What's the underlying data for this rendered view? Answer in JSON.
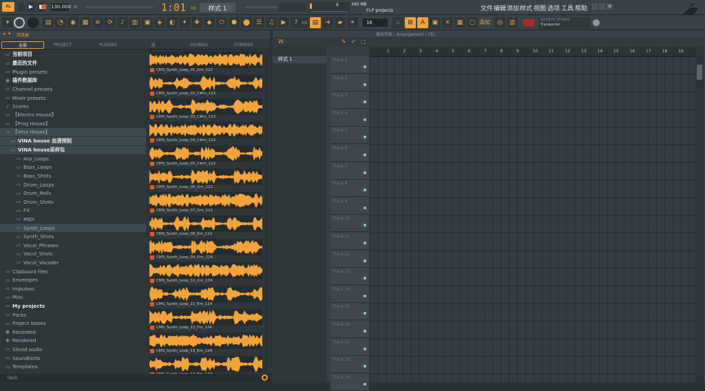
{
  "topbar": {
    "tempo": "130.000",
    "time": "1:01",
    "time_sub": "00",
    "pattern": "样式 1",
    "memory": "345 MB",
    "cpu": "6",
    "project_hint": "FLP projects",
    "menu": [
      "文件",
      "编辑",
      "添加",
      "样式",
      "视图",
      "选项",
      "工具",
      "帮助"
    ]
  },
  "toolbar": {
    "snap": "16",
    "add_label": "添加",
    "news_line1": "10/18 FL STUDIO",
    "news_line2": "Transporter"
  },
  "browser": {
    "title": "浏览器",
    "tabs": [
      "全部",
      "PROJECT",
      "PLUGINS",
      "库",
      "SOUNDS",
      "STARRED"
    ],
    "tree": [
      {
        "label": "当前项目",
        "icon": "▭",
        "style": "bold"
      },
      {
        "label": "最近的文件",
        "icon": "▭",
        "style": "bold"
      },
      {
        "label": "Plugin presets",
        "icon": "▭",
        "style": ""
      },
      {
        "label": "插件数据库",
        "icon": "◉",
        "style": "bold"
      },
      {
        "label": "Channel presets",
        "icon": "▭",
        "style": ""
      },
      {
        "label": "Mixer presets",
        "icon": "▭",
        "style": ""
      },
      {
        "label": "Scores",
        "icon": "♪",
        "style": ""
      },
      {
        "label": "【Electro House】",
        "icon": "▭",
        "style": ""
      },
      {
        "label": "【Prog House】",
        "icon": "▭",
        "style": ""
      },
      {
        "label": "【Vina House】",
        "icon": "▭",
        "style": "sel"
      },
      {
        "label": "VINA house 血清预制",
        "icon": "▭",
        "style": "sel bold"
      },
      {
        "label": "VINA house采样包",
        "icon": "▭",
        "style": "sel bold"
      },
      {
        "label": "Arp_Loops",
        "icon": "▭",
        "style": ""
      },
      {
        "label": "Bass_Loops",
        "icon": "▭",
        "style": ""
      },
      {
        "label": "Bass_Shots",
        "icon": "▭",
        "style": ""
      },
      {
        "label": "Drum_Loops",
        "icon": "▭",
        "style": ""
      },
      {
        "label": "Drum_Rolls",
        "icon": "▭",
        "style": ""
      },
      {
        "label": "Drum_Shots",
        "icon": "▭",
        "style": ""
      },
      {
        "label": "FX",
        "icon": "▭",
        "style": ""
      },
      {
        "label": "MIDI",
        "icon": "▭",
        "style": ""
      },
      {
        "label": "Synth_Loops",
        "icon": "▭",
        "style": "sel"
      },
      {
        "label": "Synth_Shots",
        "icon": "▭",
        "style": ""
      },
      {
        "label": "Vocal_Phrases",
        "icon": "▭",
        "style": ""
      },
      {
        "label": "Vocal_Shots",
        "icon": "▭",
        "style": ""
      },
      {
        "label": "Vocal_Vocoder",
        "icon": "▭",
        "style": ""
      },
      {
        "label": "Clipboard files",
        "icon": "▭",
        "style": ""
      },
      {
        "label": "Envelopes",
        "icon": "▭",
        "style": ""
      },
      {
        "label": "Impulses",
        "icon": "▭",
        "style": ""
      },
      {
        "label": "Misc",
        "icon": "▭",
        "style": ""
      },
      {
        "label": "My projects",
        "icon": "▭",
        "style": "bold"
      },
      {
        "label": "Packs",
        "icon": "▭",
        "style": ""
      },
      {
        "label": "Project bones",
        "icon": "▭",
        "style": ""
      },
      {
        "label": "Recorded",
        "icon": "◉",
        "style": ""
      },
      {
        "label": "Rendered",
        "icon": "✚",
        "style": ""
      },
      {
        "label": "Sliced audio",
        "icon": "▭",
        "style": ""
      },
      {
        "label": "Soundfonts",
        "icon": "▭",
        "style": ""
      },
      {
        "label": "Templates",
        "icon": "▭",
        "style": ""
      }
    ],
    "samples": [
      "CMS_Synth_Loop_01_Gm_122",
      "CMS_Synth_Loop_02_C#m_122",
      "CMS_Synth_Loop_03_C#m_122",
      "CMS_Synth_Loop_04_C#m_122",
      "CMS_Synth_Loop_05_C#m_122",
      "CMS_Synth_Loop_06_Gm_122",
      "CMS_Synth_Loop_07_Gm_122",
      "CMS_Synth_Loop_08_Em_122",
      "CMS_Synth_Loop_09_Dm_124",
      "CMS_Synth_Loop_10_Cm_124",
      "CMS_Synth_Loop_11_Em_124",
      "CMS_Synth_Loop_12_Fm_124",
      "CMS_Synth_Loop_13_Em_124",
      "CMS_Synth_Loop_14_Em_124"
    ],
    "footer": "TAGS"
  },
  "playlist": {
    "title": "播放列表 - Arrangement › (无)",
    "pattern_item": "样式 1",
    "ruler": [
      "1",
      "2",
      "3",
      "4",
      "5",
      "6",
      "7",
      "8",
      "9",
      "10",
      "11",
      "12",
      "13",
      "14",
      "15",
      "16",
      "17",
      "18",
      "19"
    ],
    "tracks": [
      "Track 1",
      "Track 2",
      "Track 3",
      "Track 4",
      "Track 5",
      "Track 6",
      "Track 7",
      "Track 8",
      "Track 9",
      "Track 10",
      "Track 11",
      "Track 12",
      "Track 13",
      "Track 14",
      "Track 15",
      "Track 16",
      "Track 17",
      "Track 18",
      "Track 19"
    ]
  },
  "colors": {
    "accent": "#f2a33a",
    "bg": "#2b3236",
    "play": "#e05a2c"
  }
}
